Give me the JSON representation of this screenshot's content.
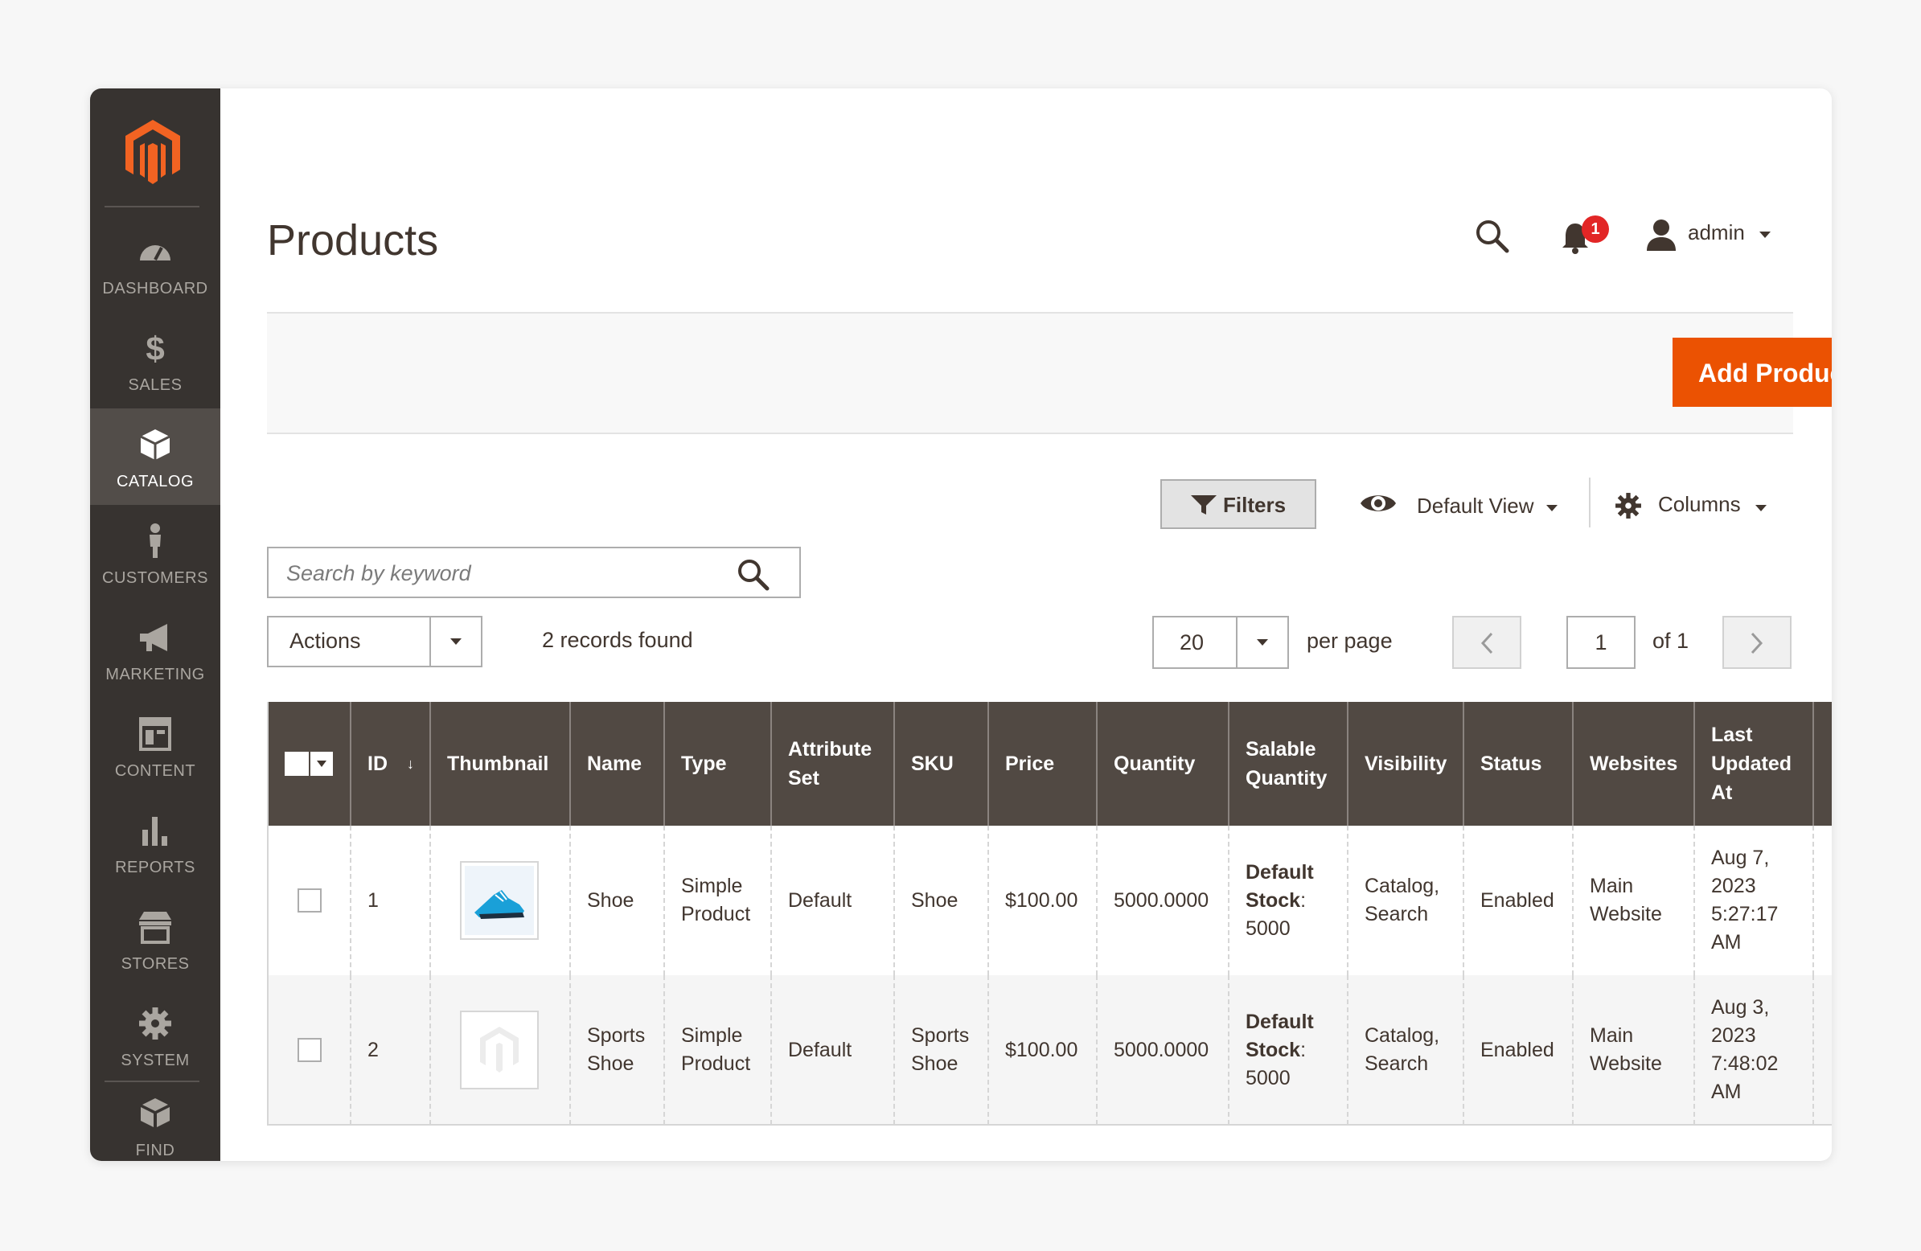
{
  "sidebar": {
    "items": [
      {
        "label": "DASHBOARD",
        "icon": "dashboard-gauge-icon"
      },
      {
        "label": "SALES",
        "icon": "dollar-icon"
      },
      {
        "label": "CATALOG",
        "icon": "cube-icon",
        "active": true
      },
      {
        "label": "CUSTOMERS",
        "icon": "person-icon"
      },
      {
        "label": "MARKETING",
        "icon": "megaphone-icon"
      },
      {
        "label": "CONTENT",
        "icon": "layout-icon"
      },
      {
        "label": "REPORTS",
        "icon": "bar-chart-icon"
      },
      {
        "label": "STORES",
        "icon": "storefront-icon"
      },
      {
        "label": "SYSTEM",
        "icon": "gear-icon"
      },
      {
        "label": "FIND PARTNERS",
        "icon": "boxes-icon"
      }
    ]
  },
  "header": {
    "title": "Products",
    "notifications_count": "1",
    "username": "admin"
  },
  "toolbar": {
    "add_product_label": "Add Product"
  },
  "controls": {
    "filters_label": "Filters",
    "view_label": "Default View",
    "columns_label": "Columns",
    "search_placeholder": "Search by keyword",
    "actions_label": "Actions",
    "records_found": "2 records found",
    "per_page_value": "20",
    "per_page_label": "per page",
    "current_page": "1",
    "page_total": "of 1"
  },
  "grid": {
    "columns": [
      "ID",
      "Thumbnail",
      "Name",
      "Type",
      "Attribute Set",
      "SKU",
      "Price",
      "Quantity",
      "Salable Quantity",
      "Visibility",
      "Status",
      "Websites",
      "Last Updated At"
    ],
    "rows": [
      {
        "id": "1",
        "name": "Shoe",
        "type": "Simple Product",
        "attribute_set": "Default",
        "sku": "Shoe",
        "price": "$100.00",
        "quantity": "5000.0000",
        "salable_label": "Default Stock",
        "salable_value": "5000",
        "visibility": "Catalog, Search",
        "status": "Enabled",
        "websites": "Main Website",
        "updated": "Aug 7, 2023 5:27:17 AM"
      },
      {
        "id": "2",
        "name": "Sports Shoe",
        "type": "Simple Product",
        "attribute_set": "Default",
        "sku": "Sports Shoe",
        "price": "$100.00",
        "quantity": "5000.0000",
        "salable_label": "Default Stock",
        "salable_value": "5000",
        "visibility": "Catalog, Search",
        "status": "Enabled",
        "websites": "Main Website",
        "updated": "Aug 3, 2023 7:48:02 AM"
      }
    ]
  },
  "colors": {
    "accent": "#eb5202",
    "sidebar_bg": "#373330",
    "grid_header_bg": "#514943"
  }
}
